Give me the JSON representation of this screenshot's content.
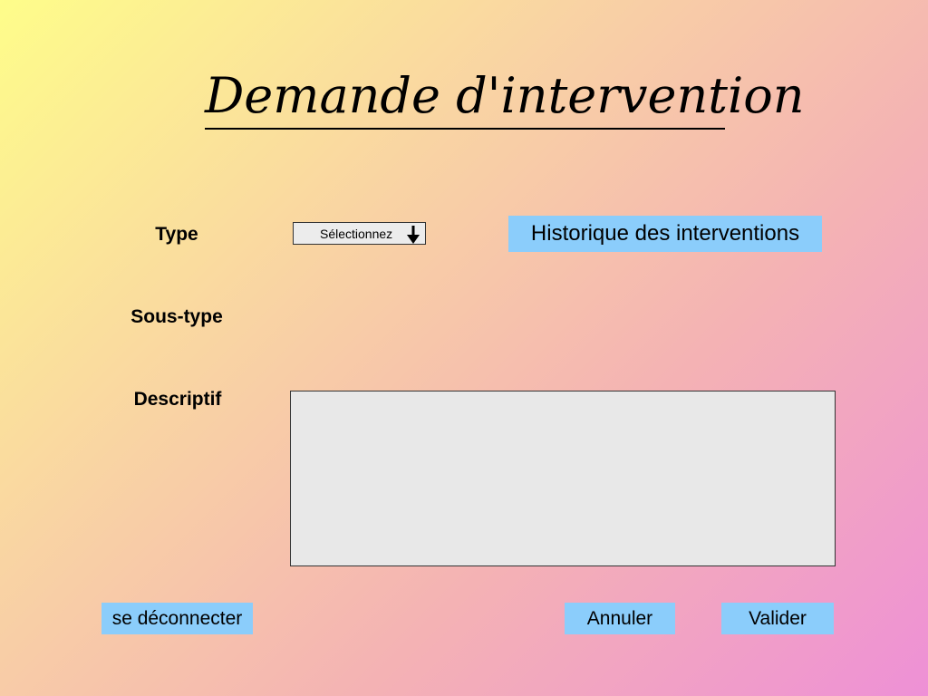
{
  "header": {
    "title": "Demande d'intervention"
  },
  "form": {
    "type_label": "Type",
    "type_select": {
      "selected_value": "Sélectionnez",
      "icon": "arrow-down-icon"
    },
    "subtype_label": "Sous-type",
    "description_label": "Descriptif",
    "description_value": ""
  },
  "history_button": {
    "label": "Historique des interventions"
  },
  "footer": {
    "logout_label": "se déconnecter",
    "cancel_label": "Annuler",
    "submit_label": "Valider"
  },
  "colors": {
    "button_background": "#8bcdfb",
    "field_background": "#e8e8e8",
    "gradient": [
      "#fefd8a",
      "#f9d4a3",
      "#f4b2b4",
      "#ee90d6"
    ]
  }
}
